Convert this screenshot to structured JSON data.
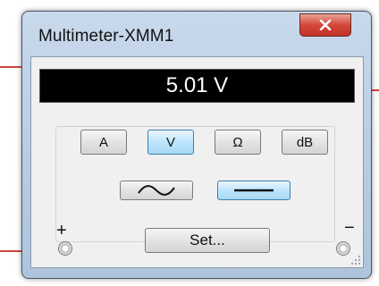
{
  "window": {
    "title": "Multimeter-XMM1"
  },
  "display": {
    "reading": "5.01 V"
  },
  "modes": [
    {
      "label": "A",
      "active": false
    },
    {
      "label": "V",
      "active": true
    },
    {
      "label": "Ω",
      "active": false
    },
    {
      "label": "dB",
      "active": false
    }
  ],
  "signal_type": {
    "selected": "DC",
    "options": [
      "AC",
      "DC"
    ]
  },
  "set_button": {
    "label": "Set..."
  },
  "terminals": {
    "positive": "+",
    "negative": "−"
  },
  "colors": {
    "wire": "#c8463c",
    "active_button": "#bee6fd",
    "close_button": "#d3483a"
  }
}
